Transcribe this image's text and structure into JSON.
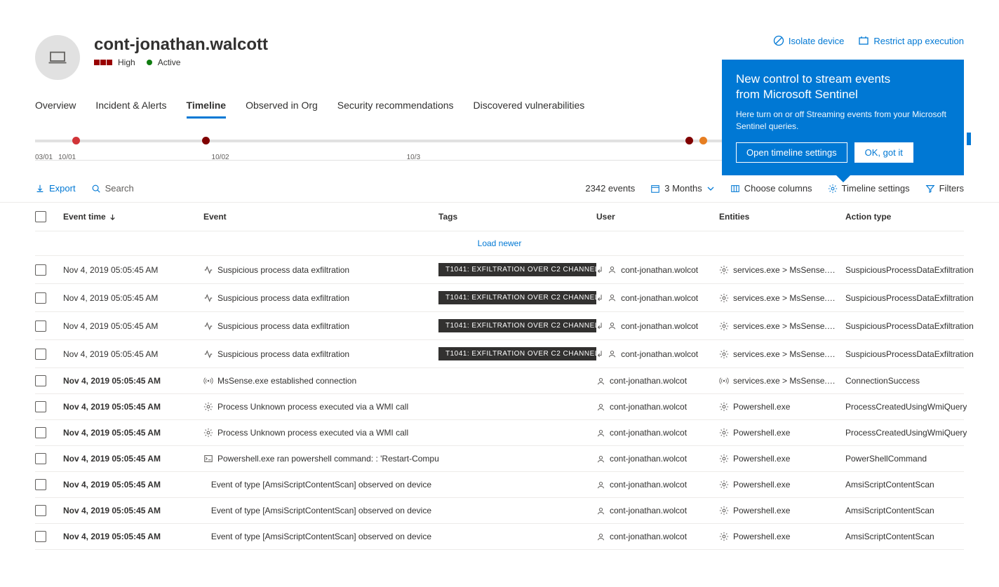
{
  "header": {
    "title": "cont-jonathan.walcott",
    "severity": "High",
    "status": "Active",
    "actions": {
      "isolate": "Isolate device",
      "restrict": "Restrict app execution"
    }
  },
  "tabs": [
    "Overview",
    "Incident & Alerts",
    "Timeline",
    "Observed in Org",
    "Security recommendations",
    "Discovered vulnerabilities"
  ],
  "activeTab": "Timeline",
  "callout": {
    "title1": "New control to stream events",
    "title2": "from Microsoft Sentinel",
    "body": "Here turn on or off Streaming events from your Microsoft Sentinel queries.",
    "btn1": "Open timeline settings",
    "btn2": "OK, got it"
  },
  "timelineLabels": [
    "03/01",
    "10/01",
    "10/02",
    "10/3"
  ],
  "toolbar": {
    "export": "Export",
    "search": "Search",
    "eventCount": "2342 events",
    "range": "3  Months",
    "columns": "Choose columns",
    "settings": "Timeline settings",
    "filters": "Filters"
  },
  "columns": {
    "time": "Event time",
    "event": "Event",
    "tags": "Tags",
    "user": "User",
    "entities": "Entities",
    "action": "Action type"
  },
  "loadNewer": "Load newer",
  "rows": [
    {
      "time": "Nov 4, 2019 05:05:45 AM",
      "bold": false,
      "icon": "activity",
      "event": "Suspicious process data exfiltration",
      "tag": "T1041: EXFILTRATION OVER C2 CHANNEL",
      "userPrefix": true,
      "user": "cont-jonathan.wolcot",
      "entities": "services.exe > MsSense.exe",
      "action": "SuspiciousProcessDataExfiltration"
    },
    {
      "time": "Nov 4, 2019 05:05:45 AM",
      "bold": false,
      "icon": "activity",
      "event": "Suspicious process data exfiltration",
      "tag": "T1041: EXFILTRATION OVER C2 CHANNEL",
      "userPrefix": true,
      "user": "cont-jonathan.wolcot",
      "entities": "services.exe > MsSense.exe",
      "action": "SuspiciousProcessDataExfiltration"
    },
    {
      "time": "Nov 4, 2019 05:05:45 AM",
      "bold": false,
      "icon": "activity",
      "event": "Suspicious process data exfiltration",
      "tag": "T1041: EXFILTRATION OVER C2 CHANNEL",
      "userPrefix": true,
      "user": "cont-jonathan.wolcot",
      "entities": "services.exe > MsSense.exe",
      "action": "SuspiciousProcessDataExfiltration"
    },
    {
      "time": "Nov 4, 2019 05:05:45 AM",
      "bold": false,
      "icon": "activity",
      "event": "Suspicious process data exfiltration",
      "tag": "T1041: EXFILTRATION OVER C2 CHANNEL",
      "userPrefix": true,
      "user": "cont-jonathan.wolcot",
      "entities": "services.exe > MsSense.exe",
      "action": "SuspiciousProcessDataExfiltration"
    },
    {
      "time": "Nov 4, 2019 05:05:45 AM",
      "bold": true,
      "icon": "broadcast",
      "event": "MsSense.exe established connection",
      "tag": "",
      "userPrefix": false,
      "user": "cont-jonathan.wolcot",
      "entitiesIcon": "broadcast",
      "entities": "services.exe > MsSense.exe",
      "action": "ConnectionSuccess"
    },
    {
      "time": "Nov 4, 2019 05:05:45 AM",
      "bold": true,
      "icon": "gear",
      "event": "Process Unknown process executed via a WMI call",
      "tag": "",
      "userPrefix": false,
      "user": "cont-jonathan.wolcot",
      "entities": "Powershell.exe",
      "action": "ProcessCreatedUsingWmiQuery"
    },
    {
      "time": "Nov 4, 2019 05:05:45 AM",
      "bold": true,
      "icon": "gear",
      "event": "Process Unknown process executed via a WMI call",
      "tag": "",
      "userPrefix": false,
      "user": "cont-jonathan.wolcot",
      "entities": "Powershell.exe",
      "action": "ProcessCreatedUsingWmiQuery"
    },
    {
      "time": "Nov 4, 2019 05:05:45 AM",
      "bold": true,
      "icon": "terminal",
      "event": "Powershell.exe ran powershell command: : 'Restart-Computer'",
      "tag": "",
      "userPrefix": false,
      "user": "cont-jonathan.wolcot",
      "entities": "Powershell.exe",
      "action": "PowerShellCommand"
    },
    {
      "time": "Nov 4, 2019 05:05:45 AM",
      "bold": true,
      "icon": "",
      "event": "Event of type [AmsiScriptContentScan] observed on device",
      "tag": "",
      "userPrefix": false,
      "user": "cont-jonathan.wolcot",
      "entities": "Powershell.exe",
      "action": "AmsiScriptContentScan"
    },
    {
      "time": "Nov 4, 2019 05:05:45 AM",
      "bold": true,
      "icon": "",
      "event": "Event of type [AmsiScriptContentScan] observed on device",
      "tag": "",
      "userPrefix": false,
      "user": "cont-jonathan.wolcot",
      "entities": "Powershell.exe",
      "action": "AmsiScriptContentScan"
    },
    {
      "time": "Nov 4, 2019 05:05:45 AM",
      "bold": true,
      "icon": "",
      "event": "Event of type [AmsiScriptContentScan] observed on device",
      "tag": "",
      "userPrefix": false,
      "user": "cont-jonathan.wolcot",
      "entities": "Powershell.exe",
      "action": "AmsiScriptContentScan"
    }
  ]
}
